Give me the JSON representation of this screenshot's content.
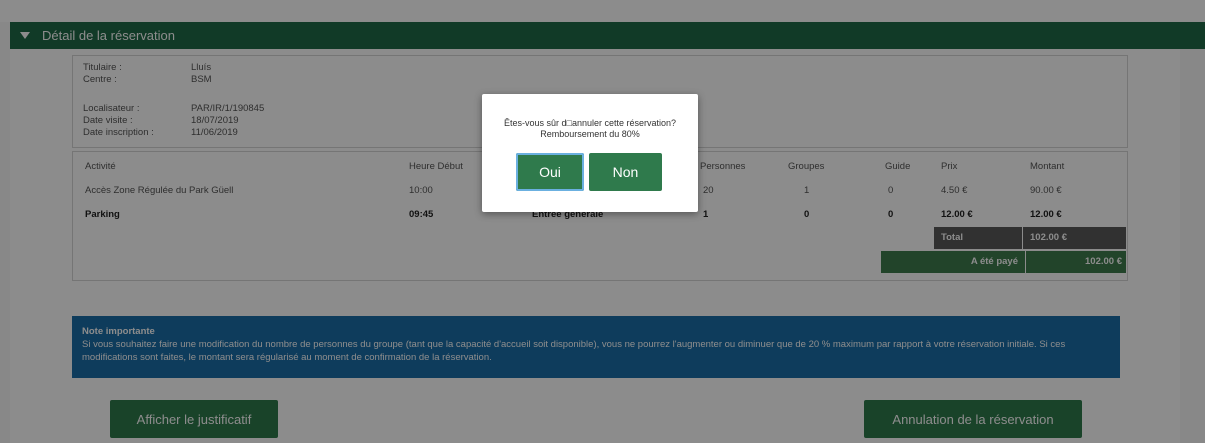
{
  "section": {
    "title": "Détail de la réservation"
  },
  "info": [
    {
      "label": "Titulaire :",
      "value": "Lluís"
    },
    {
      "label": "Centre :",
      "value": "BSM"
    },
    {
      "label": "Localisateur :",
      "value": "PAR/IR/1/190845"
    },
    {
      "label": "Date visite :",
      "value": "18/07/2019"
    },
    {
      "label": "Date inscription :",
      "value": "11/06/2019"
    }
  ],
  "table": {
    "headers": [
      "Activité",
      "Heure Début",
      "Personnes",
      "Groupes",
      "Guide",
      "Prix",
      "Montant"
    ],
    "rows": [
      {
        "activite": "Accès Zone Régulée du Park Güell",
        "heure": "10:00",
        "tarif": "",
        "personnes": "20",
        "groupes": "1",
        "guide": "0",
        "prix": "4.50 €",
        "montant": "90.00 €"
      },
      {
        "activite": "Parking",
        "heure": "09:45",
        "tarif": "Entrée générale",
        "personnes": "1",
        "groupes": "0",
        "guide": "0",
        "prix": "12.00 €",
        "montant": "12.00 €"
      }
    ],
    "total_label": "Total",
    "total_value": "102.00 €",
    "paid_label": "A été payé",
    "paid_value": "102.00 €"
  },
  "note": {
    "title": "Note importante",
    "text": "Si vous souhaitez faire une modification du nombre de personnes du groupe (tant que la capacité d'accueil soit disponible), vous ne pourrez l'augmenter ou diminuer que de 20 % maximum par rapport à votre réservation initiale. Si ces modifications sont faites, le montant sera régularisé au moment de confirmation de la réservation."
  },
  "buttons": {
    "justificatif": "Afficher le justificatif",
    "annulation": "Annulation de la réservation"
  },
  "modal": {
    "message": "Êtes-vous sûr d□annuler cette réservation? Remboursement du 80%",
    "yes": "Oui",
    "no": "Non"
  },
  "colors": {
    "header_green": "#1f6b47",
    "button_green": "#2f7a4c",
    "note_blue": "#1a6ea8",
    "total_gray": "#5a5a5a",
    "paid_green": "#3f7c4e"
  },
  "icons": {
    "collapse": "triangle-down-icon"
  }
}
